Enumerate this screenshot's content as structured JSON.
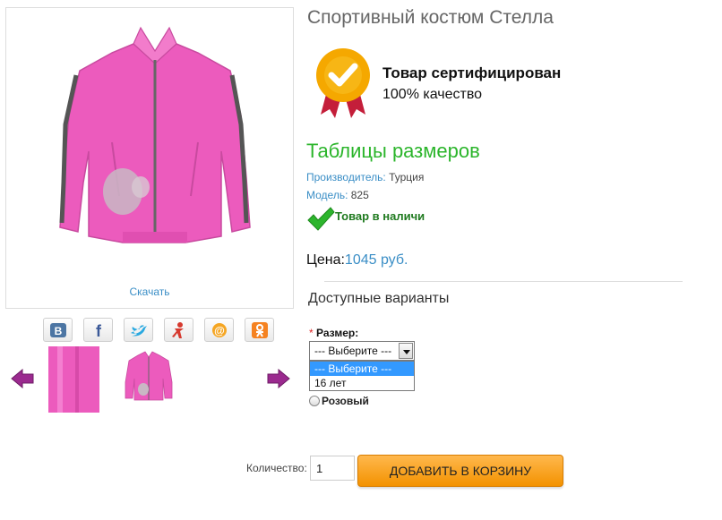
{
  "product": {
    "title": "Спортивный костюм Стелла",
    "download_label": "Скачать"
  },
  "certificate": {
    "title": "Товар сертифицирован",
    "subtitle": "100% качество"
  },
  "size_table_link": "Таблицы размеров",
  "details": {
    "manufacturer_label": "Производитель:",
    "manufacturer_value": "Турция",
    "model_label": "Модель:",
    "model_value": "825",
    "stock_status": "Товар в наличи"
  },
  "price": {
    "label": "Цена:",
    "value": "1045 руб."
  },
  "variants": {
    "heading": "Доступные варианты",
    "size_required_mark": "*",
    "size_label": "Размер:",
    "size_selected": "--- Выберите ---",
    "size_options": [
      "--- Выберите ---",
      "16 лет"
    ],
    "color_option": "Розовый"
  },
  "social_icons": [
    "vk-icon",
    "facebook-icon",
    "twitter-icon",
    "odnoklassniki-man-icon",
    "mail-ru-icon",
    "ok-icon"
  ],
  "cart": {
    "quantity_label": "Количество:",
    "quantity_value": "1",
    "add_button": "ДОБАВИТЬ В КОРЗИНУ"
  },
  "colors": {
    "link_blue": "#3a8ec6",
    "green": "#2bb52b",
    "stock_green": "#1f7a1f",
    "button_orange": "#f39200",
    "jacket_pink": "#ec5bbd"
  }
}
